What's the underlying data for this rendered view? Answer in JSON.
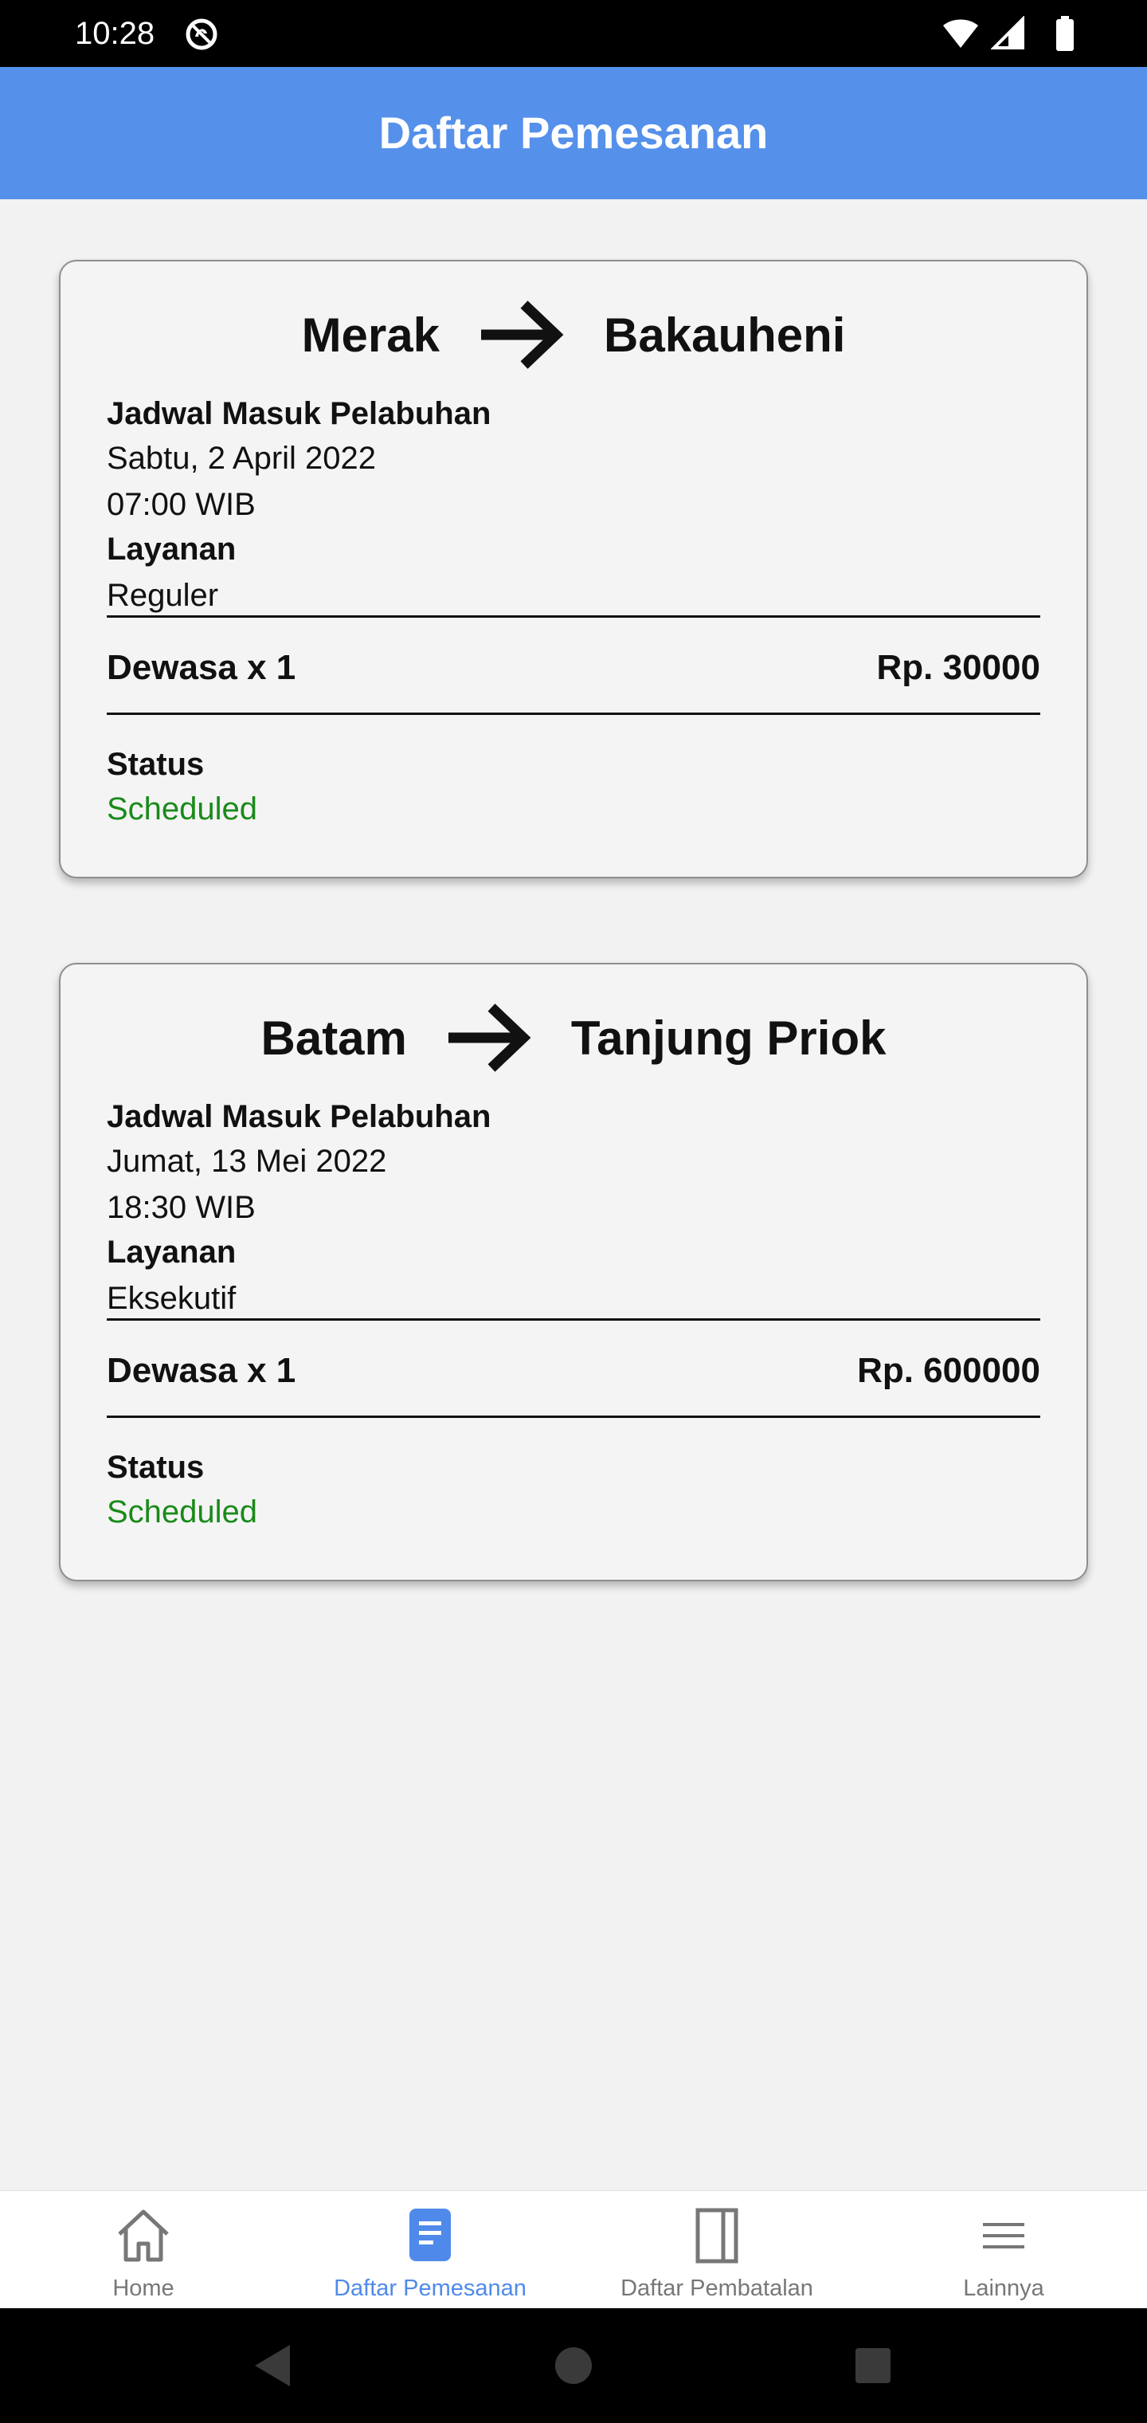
{
  "status_bar": {
    "time": "10:28"
  },
  "app_bar": {
    "title": "Daftar Pemesanan"
  },
  "bookings": [
    {
      "origin": "Merak",
      "destination": "Bakauheni",
      "schedule_label": "Jadwal Masuk Pelabuhan",
      "date": "Sabtu, 2 April 2022",
      "time": "07:00 WIB",
      "service_label": "Layanan",
      "service": "Reguler",
      "passenger": "Dewasa x 1",
      "price": "Rp. 30000",
      "status_label": "Status",
      "status": "Scheduled"
    },
    {
      "origin": "Batam",
      "destination": "Tanjung Priok",
      "schedule_label": "Jadwal Masuk Pelabuhan",
      "date": "Jumat, 13 Mei 2022",
      "time": "18:30 WIB",
      "service_label": "Layanan",
      "service": "Eksekutif",
      "passenger": "Dewasa x 1",
      "price": "Rp. 600000",
      "status_label": "Status",
      "status": "Scheduled"
    }
  ],
  "bottom_nav": [
    {
      "label": "Home",
      "icon": "home-icon",
      "active": false
    },
    {
      "label": "Daftar Pemesanan",
      "icon": "document-icon",
      "active": true
    },
    {
      "label": "Daftar Pembatalan",
      "icon": "book-icon",
      "active": false
    },
    {
      "label": "Lainnya",
      "icon": "menu-icon",
      "active": false
    }
  ],
  "colors": {
    "app_bar": "#5590ea",
    "nav_active": "#4f8aea",
    "status_scheduled": "#1a8a1a"
  }
}
